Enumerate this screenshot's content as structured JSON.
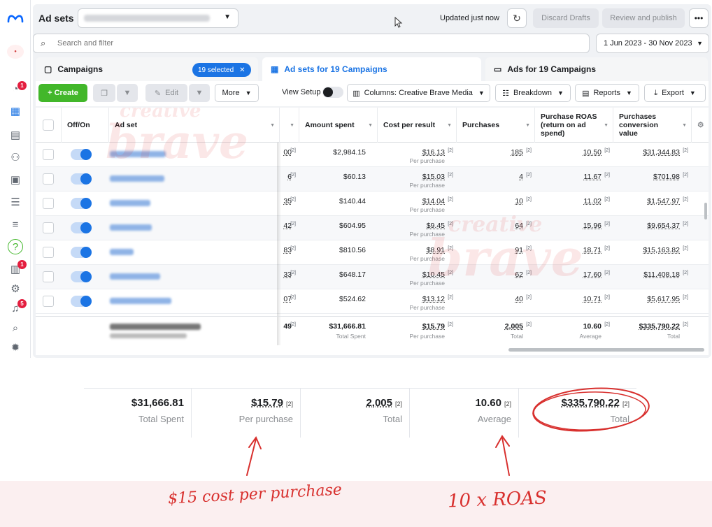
{
  "header": {
    "title": "Ad sets",
    "updated_text": "Updated just now",
    "discard_label": "Discard Drafts",
    "review_label": "Review and publish",
    "more_label": "•••"
  },
  "search": {
    "placeholder": "Search and filter"
  },
  "date_range": "1 Jun 2023 - 30 Nov 2023",
  "tabs": {
    "campaigns": "Campaigns",
    "selected_pill": "19 selected",
    "adsets": "Ad sets for 19 Campaigns",
    "ads": "Ads for 19 Campaigns"
  },
  "toolbar": {
    "create": "+ Create",
    "edit": "Edit",
    "more": "More",
    "view_setup": "View Setup",
    "columns": "Columns: Creative Brave Media",
    "breakdown": "Breakdown",
    "reports": "Reports",
    "export": "Export"
  },
  "columns": {
    "offon": "Off/On",
    "adset": "Ad set",
    "amount": "Amount spent",
    "cpr": "Cost per result",
    "purchases": "Purchases",
    "roas": "Purchase ROAS (return on ad spend)",
    "conv": "Purchases conversion value"
  },
  "ref_mark": "[2]",
  "per_purchase": "Per purchase",
  "rows": [
    {
      "partial": "00",
      "amount": "$2,984.15",
      "cpr": "$16.13",
      "purchases": "185",
      "roas": "10.50",
      "conv": "$31,344.83"
    },
    {
      "partial": "6",
      "amount": "$60.13",
      "cpr": "$15.03",
      "purchases": "4",
      "roas": "11.67",
      "conv": "$701.98"
    },
    {
      "partial": "35",
      "amount": "$140.44",
      "cpr": "$14.04",
      "purchases": "10",
      "roas": "11.02",
      "conv": "$1,547.97"
    },
    {
      "partial": "42",
      "amount": "$604.95",
      "cpr": "$9.45",
      "purchases": "64",
      "roas": "15.96",
      "conv": "$9,654.37"
    },
    {
      "partial": "83",
      "amount": "$810.56",
      "cpr": "$8.91",
      "purchases": "91",
      "roas": "18.71",
      "conv": "$15,163.82"
    },
    {
      "partial": "33",
      "amount": "$648.17",
      "cpr": "$10.45",
      "purchases": "62",
      "roas": "17.60",
      "conv": "$11,408.18"
    },
    {
      "partial": "07",
      "amount": "$524.62",
      "cpr": "$13.12",
      "purchases": "40",
      "roas": "10.71",
      "conv": "$5,617.95"
    }
  ],
  "totals": {
    "partial": "49",
    "amount": "$31,666.81",
    "amount_sub": "Total Spent",
    "cpr": "$15.79",
    "cpr_sub": "Per purchase",
    "purchases": "2,005",
    "purchases_sub": "Total",
    "roas": "10.60",
    "roas_sub": "Average",
    "conv": "$335,790.22",
    "conv_sub": "Total"
  },
  "watermark": {
    "line1": "creative",
    "line2": "brave"
  },
  "annotations": {
    "cost": "$15 cost per purchase",
    "roas": "10 x ROAS"
  },
  "colors": {
    "accent": "#1b74e4",
    "create_green": "#42b72a",
    "annotation_red": "#d8302e",
    "badge_red": "#e41e3f"
  },
  "rail": {
    "badges": [
      "1",
      "1",
      "5"
    ],
    "help": "?"
  }
}
